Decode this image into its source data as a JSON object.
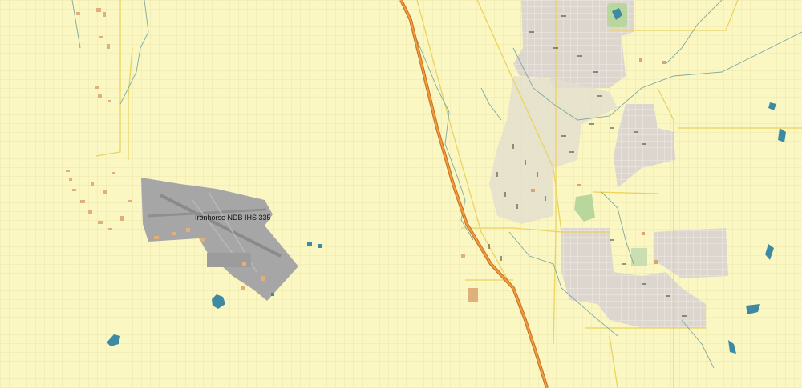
{
  "map": {
    "airport_label": "Ironhorse NDB IHS 335",
    "colors": {
      "background": "#fbf7c3",
      "grid": "#e8e2a6",
      "highway": "#e8892f",
      "highway_casing": "#c46a1f",
      "arterial": "#ecd66a",
      "stream": "#7fa8a0",
      "water": "#3e8aa3",
      "urban": "#ddd6cf",
      "airport": "#9a9a9a",
      "park": "#b7d49a",
      "building": "#e0b07c"
    }
  }
}
